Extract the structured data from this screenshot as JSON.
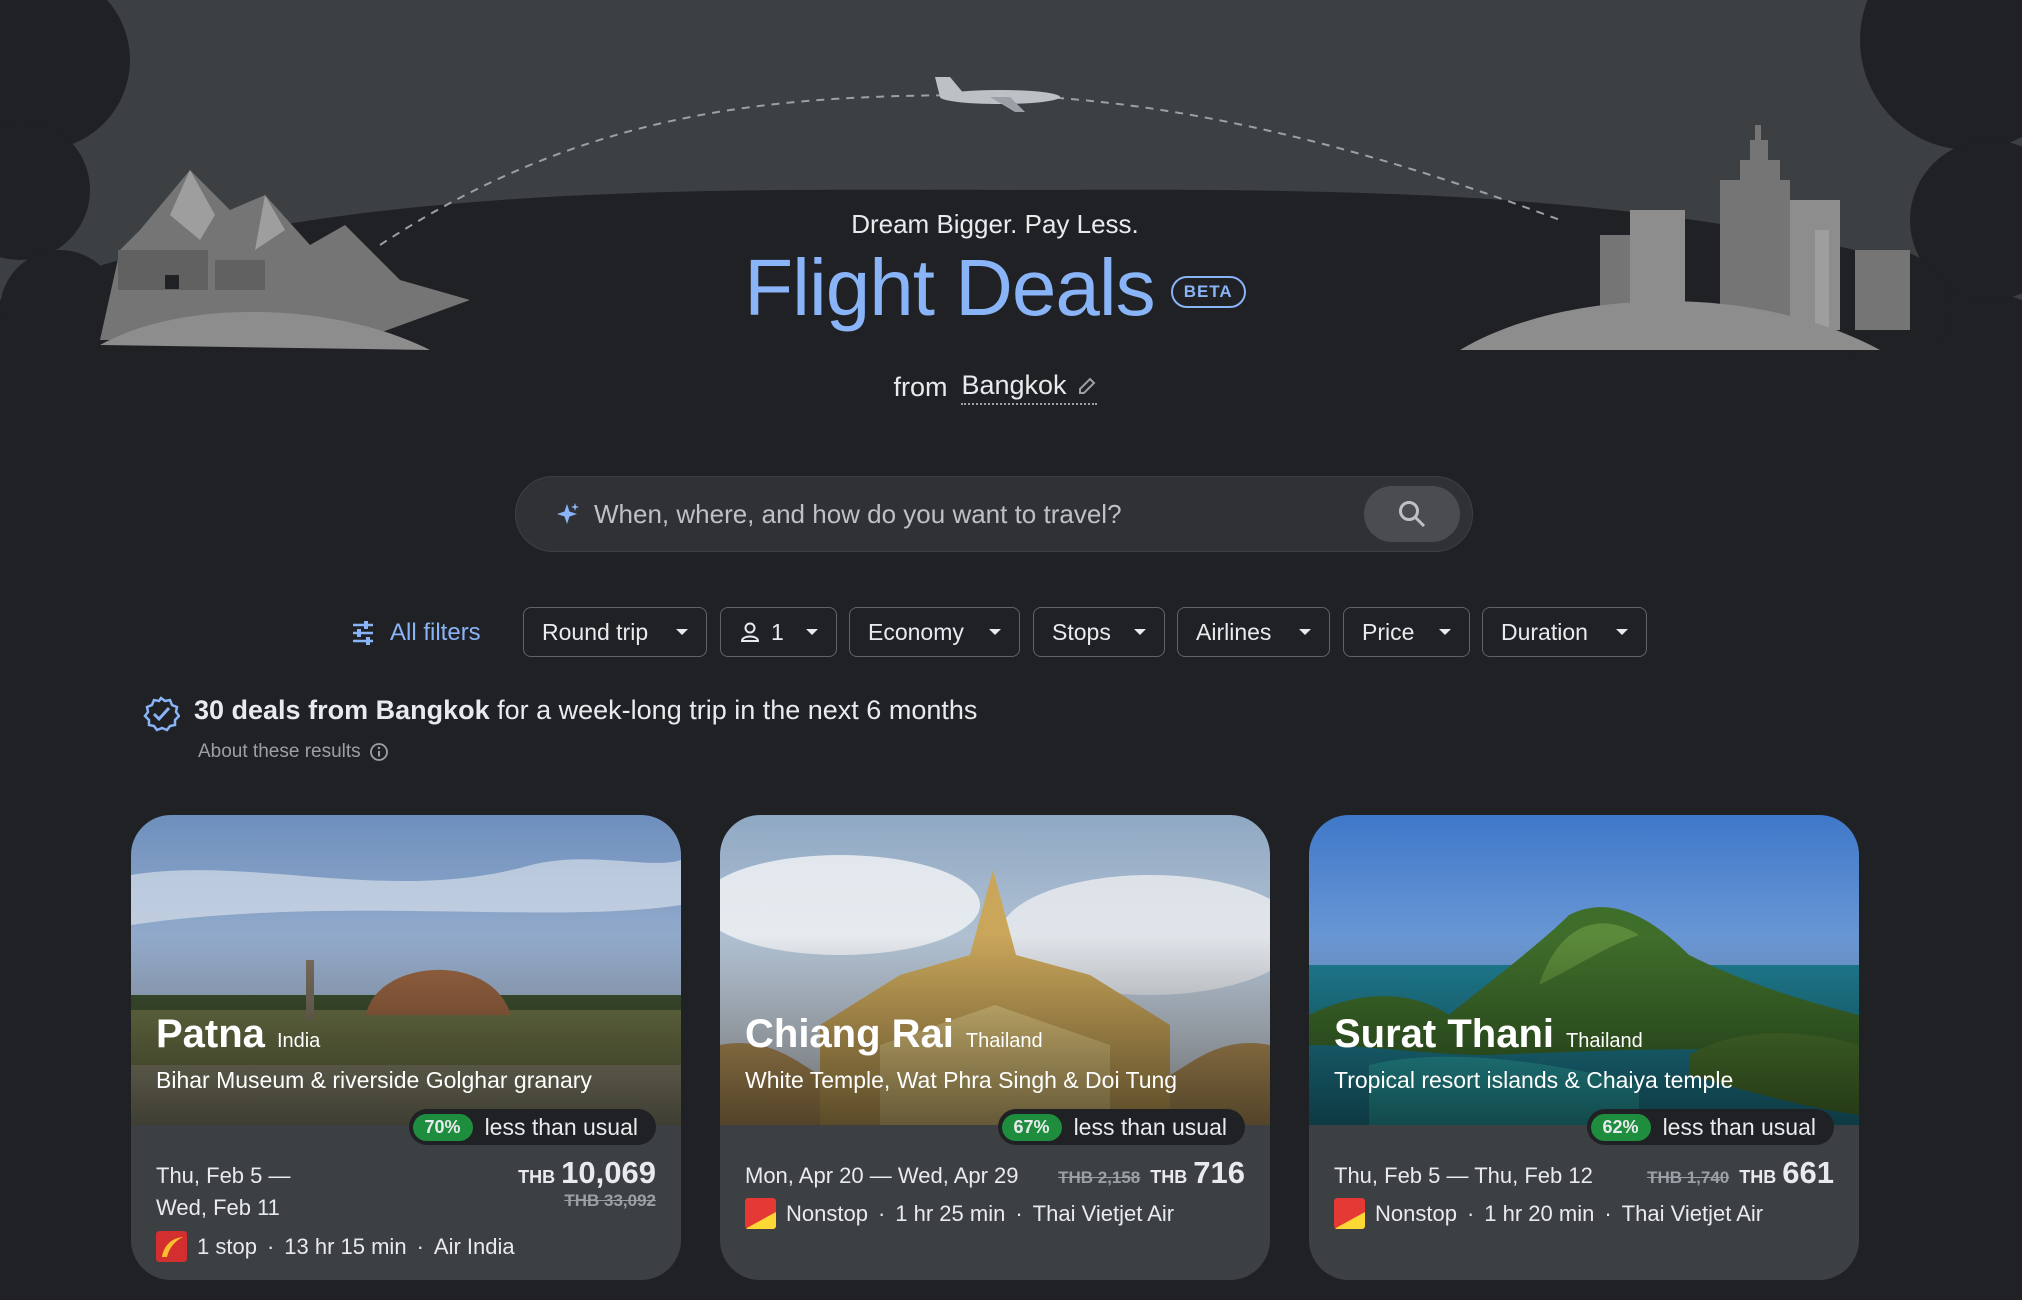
{
  "header": {
    "tagline": "Dream Bigger. Pay Less.",
    "title": "Flight Deals",
    "beta": "BETA",
    "from_label": "from",
    "origin": "Bangkok"
  },
  "search": {
    "placeholder": "When, where, and how do you want to travel?"
  },
  "filters": {
    "all_filters": "All filters",
    "trip_type": "Round trip",
    "passengers": "1",
    "cabin": "Economy",
    "stops": "Stops",
    "airlines": "Airlines",
    "price": "Price",
    "duration": "Duration"
  },
  "summary": {
    "bold": "30 deals from Bangkok",
    "rest": " for a week-long trip in the next 6 months",
    "about": "About these results"
  },
  "cards": [
    {
      "city": "Patna",
      "country": "India",
      "desc": "Bihar Museum & riverside Golghar granary",
      "pct": "70%",
      "pct_label": "less than usual",
      "date_line1": "Thu, Feb 5 —",
      "date_line2": "Wed, Feb 11",
      "currency": "THB",
      "price": "10,069",
      "old_price": "THB 33,092",
      "stops": "1 stop",
      "duration": "13 hr 15 min",
      "airline": "Air India"
    },
    {
      "city": "Chiang Rai",
      "country": "Thailand",
      "desc": "White Temple, Wat Phra Singh & Doi Tung",
      "pct": "67%",
      "pct_label": "less than usual",
      "dates": "Mon, Apr 20 — Wed, Apr 29",
      "currency": "THB",
      "price": "716",
      "old_price": "THB 2,158",
      "stops": "Nonstop",
      "duration": "1 hr 25 min",
      "airline": "Thai Vietjet Air"
    },
    {
      "city": "Surat Thani",
      "country": "Thailand",
      "desc": "Tropical resort islands & Chaiya temple",
      "pct": "62%",
      "pct_label": "less than usual",
      "dates": "Thu, Feb 5 — Thu, Feb 12",
      "currency": "THB",
      "price": "661",
      "old_price": "THB 1,740",
      "stops": "Nonstop",
      "duration": "1 hr 20 min",
      "airline": "Thai Vietjet Air"
    }
  ],
  "colors": {
    "background": "#202124",
    "accent": "#8ab4f8",
    "deal_green": "#1e8e3e",
    "card": "#3c4043"
  },
  "icons": [
    "sparkle-icon",
    "search-icon",
    "edit-pencil-icon",
    "filter-sliders-icon",
    "person-icon",
    "deal-badge-icon",
    "info-icon",
    "airplane-icon",
    "air-india-logo",
    "vietjet-logo"
  ]
}
